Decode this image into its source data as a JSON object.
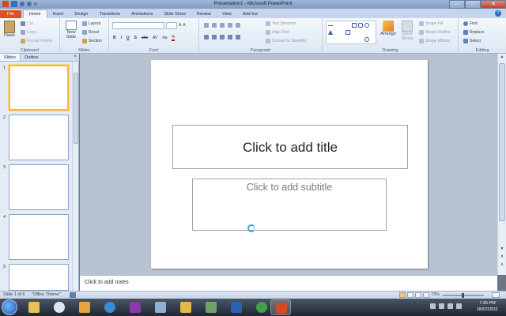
{
  "window": {
    "title": "Presentation1 - Microsoft PowerPoint",
    "minimize": "–",
    "maximize": "□",
    "close": "✕"
  },
  "tabs": [
    "File",
    "Home",
    "Insert",
    "Design",
    "Transitions",
    "Animations",
    "Slide Show",
    "Review",
    "View",
    "Add-Ins"
  ],
  "active_tab": "Home",
  "ribbon": {
    "clipboard": {
      "label": "Clipboard",
      "paste": "Paste",
      "cut": "Cut",
      "copy": "Copy",
      "format_painter": "Format Painter"
    },
    "slides": {
      "label": "Slides",
      "new_slide": "New Slide",
      "layout": "Layout",
      "reset": "Reset",
      "section": "Section"
    },
    "font": {
      "label": "Font",
      "bold": "B",
      "italic": "I",
      "underline": "U",
      "shadow": "S",
      "strike": "abc",
      "spacing": "AV",
      "case": "Aa",
      "color": "A"
    },
    "paragraph": {
      "label": "Paragraph",
      "text_direction": "Text Direction",
      "align_text": "Align Text",
      "smartart": "Convert to SmartArt"
    },
    "drawing": {
      "label": "Drawing",
      "arrange": "Arrange",
      "quick_styles": "Quick Styles",
      "shape_fill": "Shape Fill",
      "shape_outline": "Shape Outline",
      "shape_effects": "Shape Effects"
    },
    "editing": {
      "label": "Editing",
      "find": "Find",
      "replace": "Replace",
      "select": "Select"
    }
  },
  "left_pane": {
    "tabs": [
      "Slides",
      "Outline"
    ],
    "close": "×",
    "thumbnails": [
      "1",
      "2",
      "3",
      "4",
      "5"
    ]
  },
  "slide": {
    "title_placeholder": "Click to add title",
    "subtitle_placeholder": "Click to add subtitle"
  },
  "notes": {
    "placeholder": "Click to add notes"
  },
  "status": {
    "slide_info": "Slide 1 of 6",
    "theme": "\"Office Theme\"",
    "zoom": "73%"
  },
  "taskbar": {
    "time": "7:35 PM",
    "date": "18/07/2011"
  }
}
